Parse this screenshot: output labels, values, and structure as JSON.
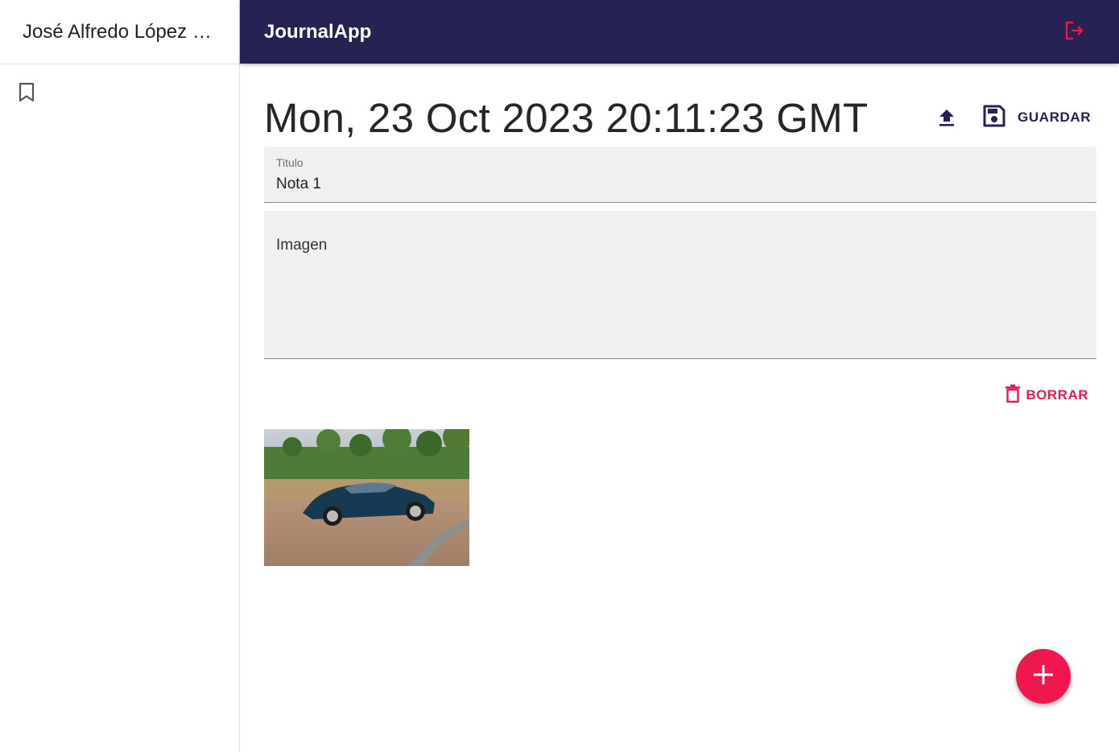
{
  "sidebar": {
    "user_name": "José Alfredo López Gutiérrez",
    "entries_icon": "bookmark-icon"
  },
  "appbar": {
    "title": "JournalApp",
    "logout_icon": "logout-icon",
    "background": "#262254",
    "accent": "#ea1a4d"
  },
  "note": {
    "date": "Mon, 23 Oct 2023 20:11:23 GMT",
    "save_label": "GUARDAR",
    "title_label": "Titulo",
    "title_value": "Nota 1",
    "body_placeholder": "Imagen",
    "delete_label": "BORRAR"
  },
  "gallery": {
    "images": [
      {
        "alt": "Dark blue coupe parked on a brick plaza"
      }
    ]
  },
  "fab": {
    "icon": "plus-icon",
    "color": "#f0174f"
  }
}
